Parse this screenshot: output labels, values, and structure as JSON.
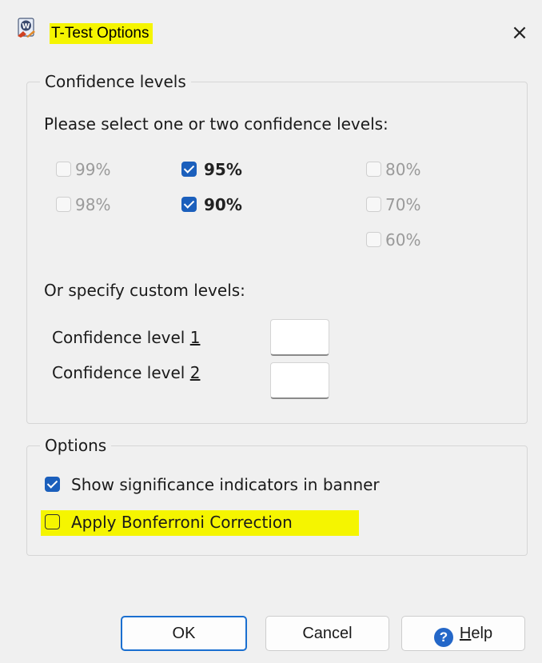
{
  "window": {
    "title": "T-Test Options",
    "close_glyph": "×",
    "icon": "wincross-app-icon"
  },
  "confidence_group": {
    "legend": "Confidence levels",
    "prompt": "Please select one or two confidence levels:",
    "checkboxes": [
      {
        "label": "99%",
        "checked": false,
        "enabled": false
      },
      {
        "label": "98%",
        "checked": false,
        "enabled": false
      },
      {
        "label": "95%",
        "checked": true,
        "enabled": true
      },
      {
        "label": "90%",
        "checked": true,
        "enabled": true
      },
      {
        "label": "80%",
        "checked": false,
        "enabled": false
      },
      {
        "label": "70%",
        "checked": false,
        "enabled": false
      },
      {
        "label": "60%",
        "checked": false,
        "enabled": false
      }
    ],
    "custom_prompt": "Or specify custom levels:",
    "custom_fields": [
      {
        "label_prefix": "Confidence level ",
        "label_mnemonic": "1",
        "value": ""
      },
      {
        "label_prefix": "Confidence level ",
        "label_mnemonic": "2",
        "value": ""
      }
    ]
  },
  "options_group": {
    "legend": "Options",
    "show_significance": {
      "label": "Show significance indicators in banner",
      "checked": true
    },
    "bonferroni": {
      "label": "Apply Bonferroni Correction",
      "checked": false
    }
  },
  "buttons": {
    "ok": "OK",
    "cancel": "Cancel",
    "help_mnemonic": "H",
    "help_rest": "elp",
    "help_icon_glyph": "?"
  },
  "colors": {
    "highlight": "#f5f500",
    "checkbox_accent": "#1b5fbc",
    "default_button_border": "#1a6fd0",
    "help_icon": "#2467c8"
  }
}
